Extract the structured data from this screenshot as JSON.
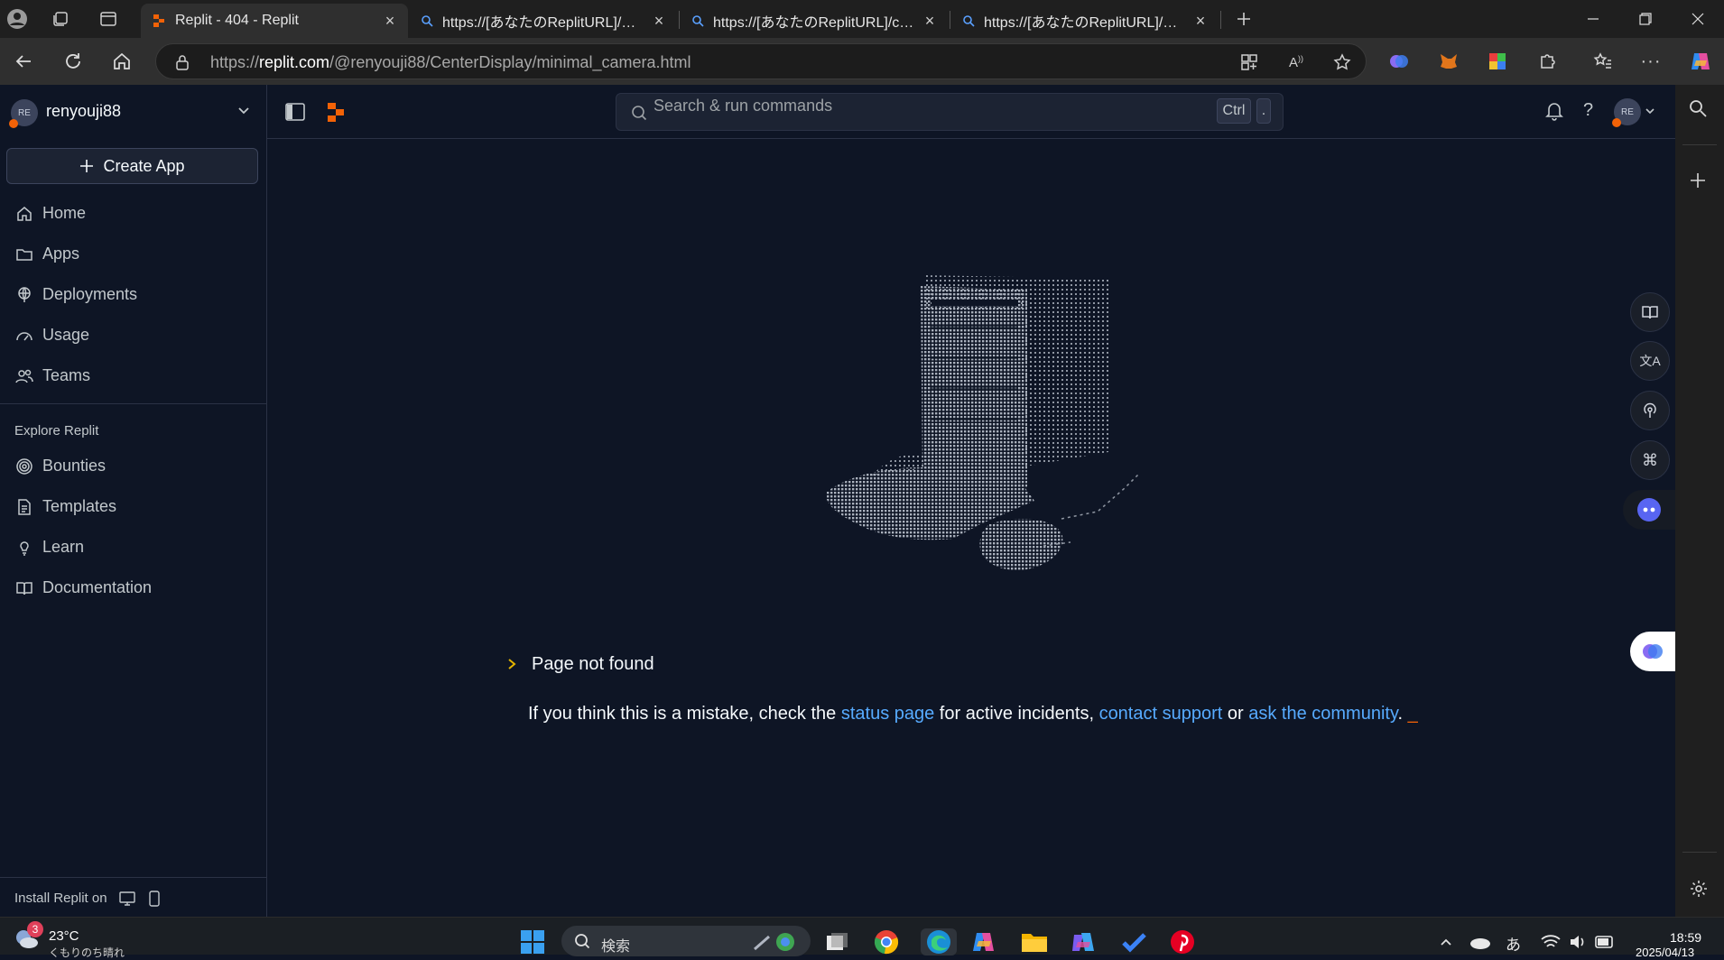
{
  "browser": {
    "tabs": [
      {
        "title": "Replit - 404 - Replit",
        "active": true
      },
      {
        "title": "https://[あなたのReplitURL]/minimal_camera.html",
        "active": false
      },
      {
        "title": "https://[あなたのReplitURL]/camera.html",
        "active": false
      },
      {
        "title": "https://[あなたのReplitURL]/minimal_camera.html",
        "active": false
      }
    ],
    "url_prefix": "https://",
    "url_domain": "replit.com",
    "url_path": "/@renyouji88/CenterDisplay/minimal_camera.html"
  },
  "sidebar": {
    "username": "renyouji88",
    "avatar_initials": "RE",
    "create_label": "Create App",
    "nav": [
      {
        "label": "Home",
        "icon": "home-icon"
      },
      {
        "label": "Apps",
        "icon": "folder-icon"
      },
      {
        "label": "Deployments",
        "icon": "globe-icon"
      },
      {
        "label": "Usage",
        "icon": "gauge-icon"
      },
      {
        "label": "Teams",
        "icon": "people-icon"
      }
    ],
    "explore_title": "Explore Replit",
    "explore": [
      {
        "label": "Bounties",
        "icon": "target-icon"
      },
      {
        "label": "Templates",
        "icon": "template-icon"
      },
      {
        "label": "Learn",
        "icon": "lightbulb-icon"
      },
      {
        "label": "Documentation",
        "icon": "book-icon"
      }
    ],
    "install_label": "Install Replit on"
  },
  "header": {
    "search_placeholder": "Search & run commands",
    "kbd_ctrl": "Ctrl",
    "kbd_dot": "."
  },
  "main": {
    "not_found": "Page not found",
    "msg_before": "If you think this is a mistake, check the ",
    "status_link": "status page",
    "msg_mid": " for active incidents, ",
    "support_link": "contact support",
    "msg_or": " or ",
    "community_link": "ask the community",
    "msg_end": ".",
    "cursor": "_"
  },
  "taskbar": {
    "weather_temp": "23°C",
    "weather_badge": "3",
    "weather_desc": "くもりのち晴れ",
    "search_text": "検索",
    "time": "18:59",
    "date": "2025/04/13",
    "ime": "あ"
  },
  "colors": {
    "bg": "#0e1525",
    "accent": "#f26207",
    "link": "#57abff"
  }
}
